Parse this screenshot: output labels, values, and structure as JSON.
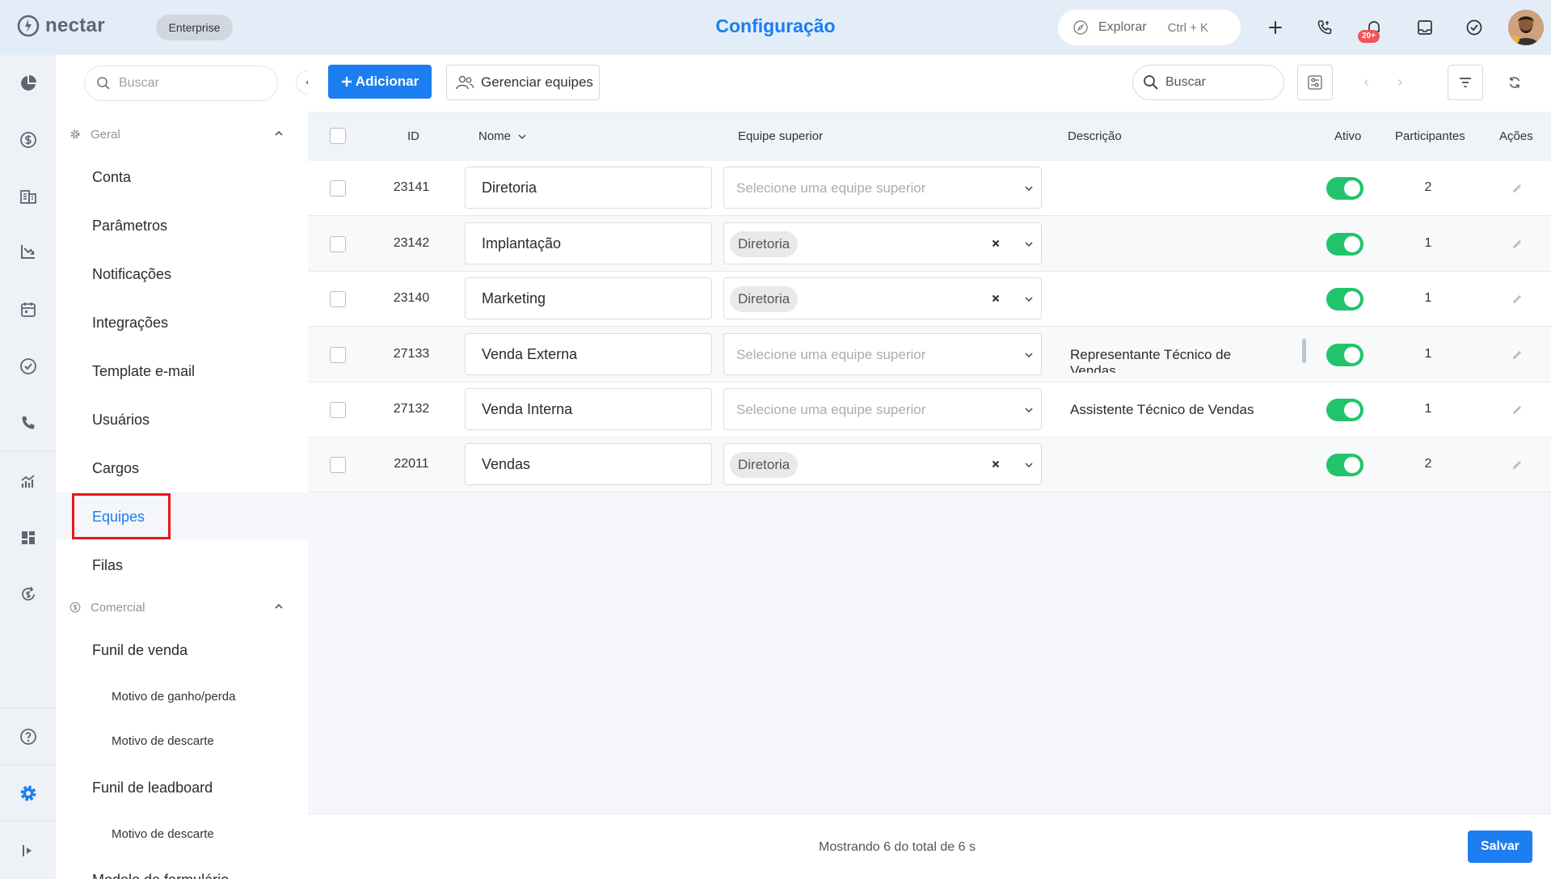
{
  "header": {
    "logo_text": "nectar",
    "plan_badge": "Enterprise",
    "title": "Configuração",
    "explore_label": "Explorar",
    "explore_shortcut": "Ctrl + K",
    "notification_count": "20+",
    "accent_color": "#1c7ef0"
  },
  "rail": {
    "icons": [
      "dashboard-icon",
      "dollar-icon",
      "building-icon",
      "chart-down-icon",
      "calendar-icon",
      "check-circle-icon",
      "phone-icon",
      "analytics-icon",
      "widgets-icon",
      "refresh-dollar-icon",
      "help-icon",
      "settings-icon",
      "expand-icon"
    ]
  },
  "sidebar": {
    "search_placeholder": "Buscar",
    "sections": [
      {
        "label": "Geral",
        "items": [
          "Conta",
          "Parâmetros",
          "Notificações",
          "Integrações",
          "Template e-mail",
          "Usuários",
          "Cargos",
          "Equipes",
          "Filas"
        ],
        "active": "Equipes"
      },
      {
        "label": "Comercial",
        "items": [
          "Funil de venda",
          "Motivo de ganho/perda",
          "Motivo de descarte",
          "Funil de leadboard",
          "Motivo de descarte",
          "Modelo de formulário"
        ]
      }
    ]
  },
  "toolbar": {
    "add_label": "Adicionar",
    "manage_label": "Gerenciar equipes",
    "search_placeholder": "Buscar"
  },
  "table": {
    "columns": [
      "ID",
      "Nome",
      "Equipe superior",
      "Descrição",
      "Ativo",
      "Participantes",
      "Ações"
    ],
    "select_placeholder": "Selecione uma equipe superior",
    "rows": [
      {
        "id": "23141",
        "name": "Diretoria",
        "parent": "",
        "description": "",
        "active": true,
        "participants": "2"
      },
      {
        "id": "23142",
        "name": "Implantação",
        "parent": "Diretoria",
        "description": "",
        "active": true,
        "participants": "1"
      },
      {
        "id": "23140",
        "name": "Marketing",
        "parent": "Diretoria",
        "description": "",
        "active": true,
        "participants": "1"
      },
      {
        "id": "27133",
        "name": "Venda Externa",
        "parent": "",
        "description": "Representante Técnico de Vendas",
        "active": true,
        "participants": "1"
      },
      {
        "id": "27132",
        "name": "Venda Interna",
        "parent": "",
        "description": "Assistente Técnico de Vendas",
        "active": true,
        "participants": "1"
      },
      {
        "id": "22011",
        "name": "Vendas",
        "parent": "Diretoria",
        "description": "",
        "active": true,
        "participants": "2"
      }
    ]
  },
  "footer": {
    "status_text": "Mostrando 6 do total de 6 s",
    "save_label": "Salvar"
  }
}
